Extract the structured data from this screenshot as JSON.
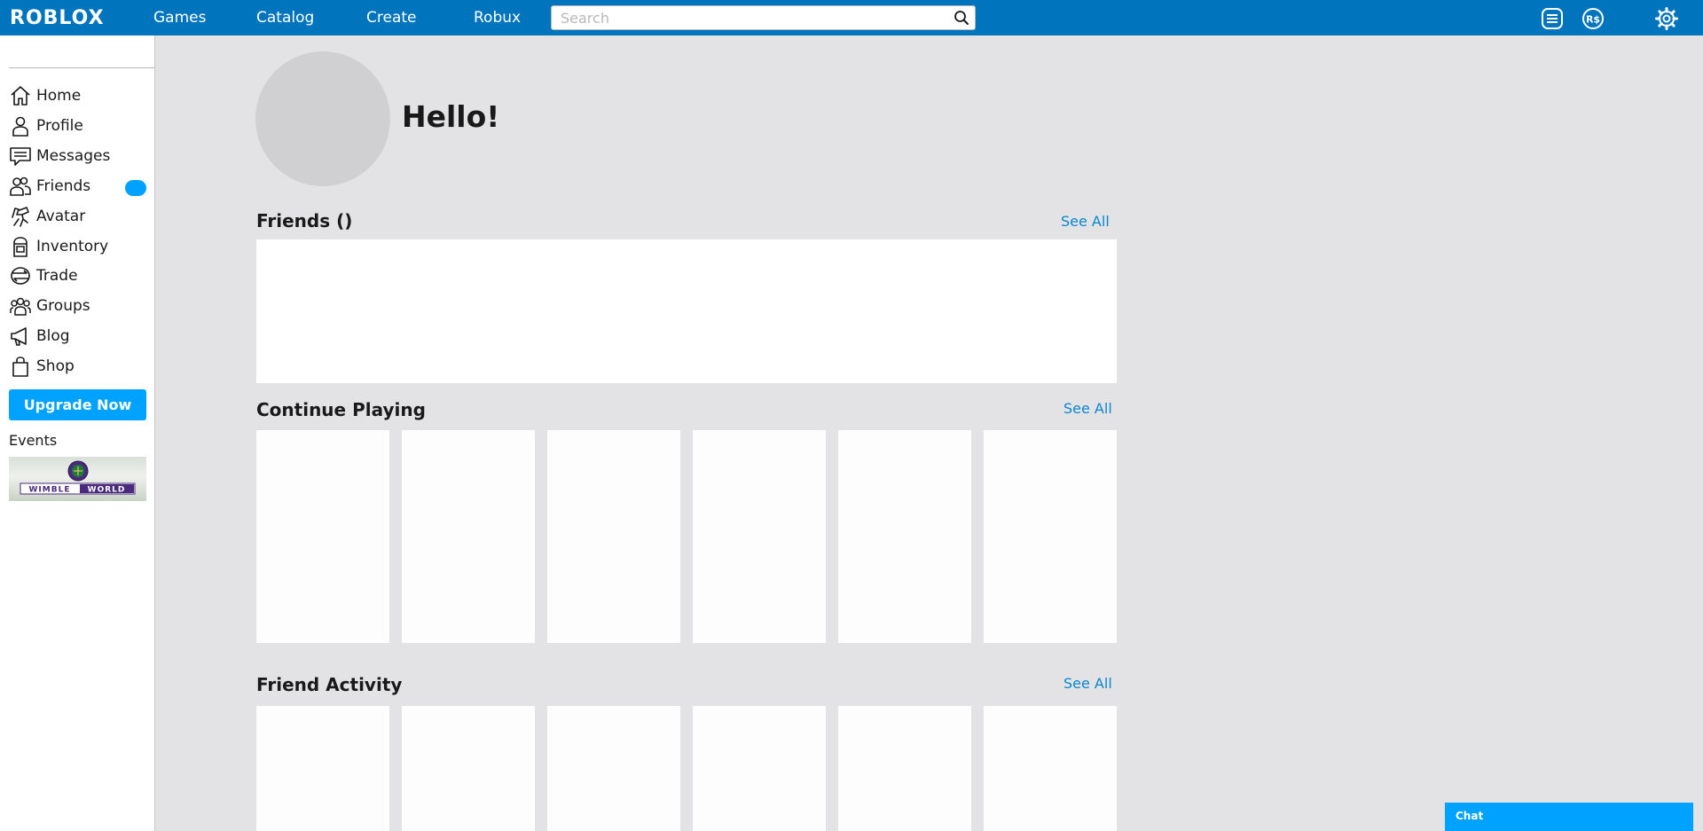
{
  "topnav": {
    "logo": "ROBLOX",
    "links": [
      "Games",
      "Catalog",
      "Create",
      "Robux"
    ],
    "search_placeholder": "Search"
  },
  "sidebar": {
    "items": [
      {
        "label": "Home",
        "icon": "home-icon"
      },
      {
        "label": "Profile",
        "icon": "profile-icon"
      },
      {
        "label": "Messages",
        "icon": "messages-icon"
      },
      {
        "label": "Friends",
        "icon": "friends-icon"
      },
      {
        "label": "Avatar",
        "icon": "avatar-icon"
      },
      {
        "label": "Inventory",
        "icon": "inventory-icon"
      },
      {
        "label": "Trade",
        "icon": "trade-icon"
      },
      {
        "label": "Groups",
        "icon": "groups-icon"
      },
      {
        "label": "Blog",
        "icon": "blog-icon"
      },
      {
        "label": "Shop",
        "icon": "shop-icon"
      }
    ],
    "upgrade_label": "Upgrade Now",
    "events_label": "Events",
    "event_banner_text": "WIMBLEWORLD"
  },
  "main": {
    "greeting": "Hello!",
    "friends_title": "Friends ()",
    "continue_title": "Continue Playing",
    "activity_title": "Friend Activity",
    "see_all": "See All"
  },
  "chat": {
    "label": "Chat"
  },
  "colors": {
    "topbar": "#0074bd",
    "accent": "#00a2ff",
    "link": "#0a86cf",
    "background": "#e3e3e5"
  }
}
